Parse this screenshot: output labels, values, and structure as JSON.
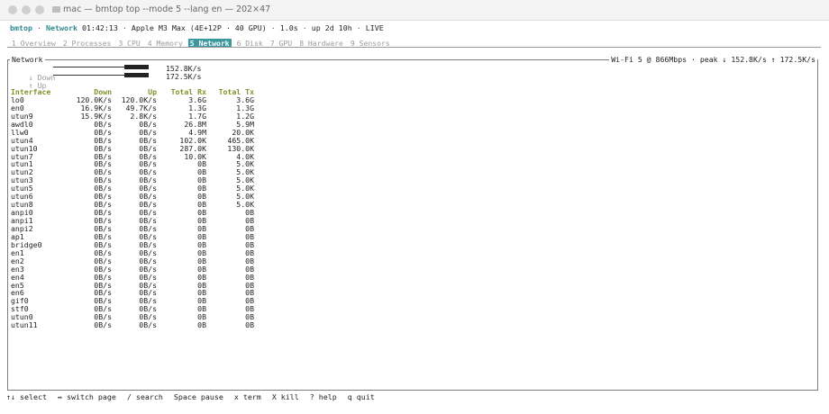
{
  "window": {
    "title": "mac — bmtop top --mode 5 --lang en — 202×47"
  },
  "status": {
    "app": "bmtop",
    "sep": " · ",
    "page": "Network",
    "time": "01:42:13",
    "machine": "Apple M3 Max (4E+12P · 40 GPU)",
    "interval": "1.0s",
    "uptime": "up 2d 10h",
    "state": "LIVE"
  },
  "tabs": [
    {
      "label": "1 Overview",
      "active": false
    },
    {
      "label": "2 Processes",
      "active": false
    },
    {
      "label": "3 CPU",
      "active": false
    },
    {
      "label": "4 Memory",
      "active": false
    },
    {
      "label": "5 Network",
      "active": true
    },
    {
      "label": "6 Disk",
      "active": false
    },
    {
      "label": "7 GPU",
      "active": false
    },
    {
      "label": "8 Hardware",
      "active": false
    },
    {
      "label": "9 Sensors",
      "active": false
    }
  ],
  "panel": {
    "title": "Network",
    "summary": "Wi-Fi 5 @ 866Mbps · peak ↓ 152.8K/s ↑ 172.5K/s"
  },
  "meters": {
    "down": {
      "label": "↓ Down",
      "value": "152.8K/s",
      "level": 0.95
    },
    "up": {
      "label": "↑ Up",
      "value": "172.5K/s",
      "level": 0.95
    }
  },
  "table": {
    "headers": {
      "iface": "Interface",
      "down": "Down",
      "up": "Up",
      "rx": "Total Rx",
      "tx": "Total Tx"
    },
    "rows": [
      {
        "iface": "lo0",
        "down": "120.0K/s",
        "up": "120.0K/s",
        "rx": "3.6G",
        "tx": "3.6G"
      },
      {
        "iface": "en0",
        "down": "16.9K/s",
        "up": "49.7K/s",
        "rx": "1.3G",
        "tx": "1.3G"
      },
      {
        "iface": "utun9",
        "down": "15.9K/s",
        "up": "2.8K/s",
        "rx": "1.7G",
        "tx": "1.2G"
      },
      {
        "iface": "awdl0",
        "down": "0B/s",
        "up": "0B/s",
        "rx": "26.8M",
        "tx": "5.9M"
      },
      {
        "iface": "llw0",
        "down": "0B/s",
        "up": "0B/s",
        "rx": "4.9M",
        "tx": "20.0K"
      },
      {
        "iface": "utun4",
        "down": "0B/s",
        "up": "0B/s",
        "rx": "102.0K",
        "tx": "465.0K"
      },
      {
        "iface": "utun10",
        "down": "0B/s",
        "up": "0B/s",
        "rx": "287.0K",
        "tx": "130.0K"
      },
      {
        "iface": "utun7",
        "down": "0B/s",
        "up": "0B/s",
        "rx": "10.0K",
        "tx": "4.0K"
      },
      {
        "iface": "utun1",
        "down": "0B/s",
        "up": "0B/s",
        "rx": "0B",
        "tx": "5.0K"
      },
      {
        "iface": "utun2",
        "down": "0B/s",
        "up": "0B/s",
        "rx": "0B",
        "tx": "5.0K"
      },
      {
        "iface": "utun3",
        "down": "0B/s",
        "up": "0B/s",
        "rx": "0B",
        "tx": "5.0K"
      },
      {
        "iface": "utun5",
        "down": "0B/s",
        "up": "0B/s",
        "rx": "0B",
        "tx": "5.0K"
      },
      {
        "iface": "utun6",
        "down": "0B/s",
        "up": "0B/s",
        "rx": "0B",
        "tx": "5.0K"
      },
      {
        "iface": "utun8",
        "down": "0B/s",
        "up": "0B/s",
        "rx": "0B",
        "tx": "5.0K"
      },
      {
        "iface": "anpi0",
        "down": "0B/s",
        "up": "0B/s",
        "rx": "0B",
        "tx": "0B"
      },
      {
        "iface": "anpi1",
        "down": "0B/s",
        "up": "0B/s",
        "rx": "0B",
        "tx": "0B"
      },
      {
        "iface": "anpi2",
        "down": "0B/s",
        "up": "0B/s",
        "rx": "0B",
        "tx": "0B"
      },
      {
        "iface": "ap1",
        "down": "0B/s",
        "up": "0B/s",
        "rx": "0B",
        "tx": "0B"
      },
      {
        "iface": "bridge0",
        "down": "0B/s",
        "up": "0B/s",
        "rx": "0B",
        "tx": "0B"
      },
      {
        "iface": "en1",
        "down": "0B/s",
        "up": "0B/s",
        "rx": "0B",
        "tx": "0B"
      },
      {
        "iface": "en2",
        "down": "0B/s",
        "up": "0B/s",
        "rx": "0B",
        "tx": "0B"
      },
      {
        "iface": "en3",
        "down": "0B/s",
        "up": "0B/s",
        "rx": "0B",
        "tx": "0B"
      },
      {
        "iface": "en4",
        "down": "0B/s",
        "up": "0B/s",
        "rx": "0B",
        "tx": "0B"
      },
      {
        "iface": "en5",
        "down": "0B/s",
        "up": "0B/s",
        "rx": "0B",
        "tx": "0B"
      },
      {
        "iface": "en6",
        "down": "0B/s",
        "up": "0B/s",
        "rx": "0B",
        "tx": "0B"
      },
      {
        "iface": "gif0",
        "down": "0B/s",
        "up": "0B/s",
        "rx": "0B",
        "tx": "0B"
      },
      {
        "iface": "stf0",
        "down": "0B/s",
        "up": "0B/s",
        "rx": "0B",
        "tx": "0B"
      },
      {
        "iface": "utun0",
        "down": "0B/s",
        "up": "0B/s",
        "rx": "0B",
        "tx": "0B"
      },
      {
        "iface": "utun11",
        "down": "0B/s",
        "up": "0B/s",
        "rx": "0B",
        "tx": "0B"
      }
    ]
  },
  "footer": [
    "↑↓ select",
    "↔ switch page",
    "/ search",
    "Space pause",
    "x term",
    "X kill",
    "? help",
    "q quit"
  ],
  "colors": {
    "accent": "#3c98a0",
    "header": "#7d9428"
  },
  "icons": {
    "window_icon": "folder-icon"
  }
}
